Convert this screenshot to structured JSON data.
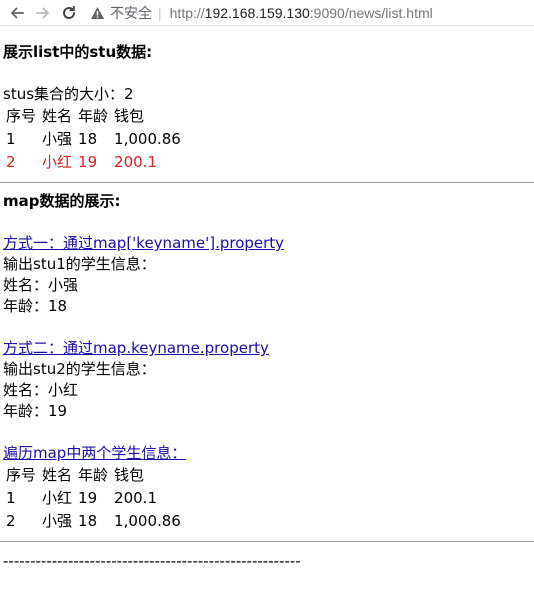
{
  "browser": {
    "security_label": "不安全",
    "url_scheme": "http://",
    "url_host": "192.168.159.130",
    "url_rest": ":9090/news/list.html"
  },
  "section_list": {
    "heading": "展示list中的stu数据:",
    "size_text": "stus集合的大小：2",
    "columns": [
      "序号",
      "姓名",
      "年龄",
      "钱包"
    ],
    "rows": [
      {
        "no": "1",
        "name": "小强",
        "age": "18",
        "wallet": "1,000.86"
      },
      {
        "no": "2",
        "name": "小红",
        "age": "19",
        "wallet": "200.1"
      }
    ],
    "highlight_color": "#e02020"
  },
  "section_map": {
    "heading": "map数据的展示:",
    "way1_link": "方式一：通过map['keyname'].property",
    "stu1_title": "输出stu1的学生信息：",
    "stu1_name": "姓名：小强",
    "stu1_age": "年龄：18",
    "way2_link": "方式二：通过map.keyname.property",
    "stu2_title": "输出stu2的学生信息：",
    "stu2_name": "姓名：小红",
    "stu2_age": "年龄：19",
    "iterate_link": "遍历map中两个学生信息：",
    "columns": [
      "序号",
      "姓名",
      "年龄",
      "钱包"
    ],
    "rows": [
      {
        "no": "1",
        "name": "小红",
        "age": "19",
        "wallet": "200.1"
      },
      {
        "no": "2",
        "name": "小强",
        "age": "18",
        "wallet": "1,000.86"
      }
    ]
  },
  "footer": {
    "dashes": "-------------------------------------------------------"
  }
}
